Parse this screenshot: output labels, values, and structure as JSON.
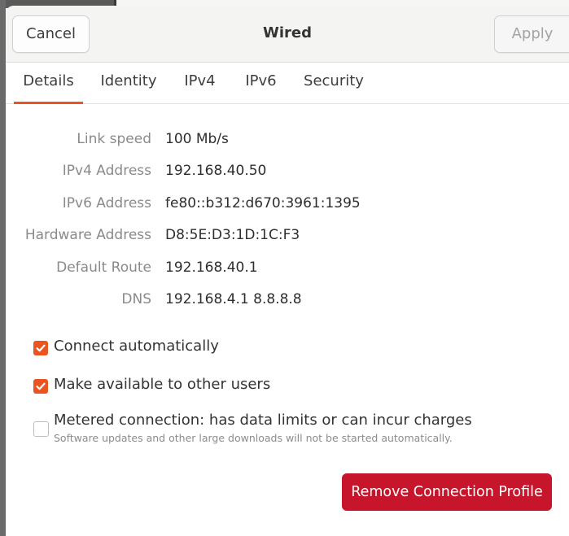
{
  "window": {
    "title": "Wired",
    "cancel_label": "Cancel",
    "apply_label": "Apply"
  },
  "tabs": [
    {
      "label": "Details",
      "active": true
    },
    {
      "label": "Identity",
      "active": false
    },
    {
      "label": "IPv4",
      "active": false
    },
    {
      "label": "IPv6",
      "active": false
    },
    {
      "label": "Security",
      "active": false
    }
  ],
  "details": [
    {
      "label": "Link speed",
      "value": "100 Mb/s"
    },
    {
      "label": "IPv4 Address",
      "value": "192.168.40.50"
    },
    {
      "label": "IPv6 Address",
      "value": "fe80::b312:d670:3961:1395"
    },
    {
      "label": "Hardware Address",
      "value": "D8:5E:D3:1D:1C:F3"
    },
    {
      "label": "Default Route",
      "value": "192.168.40.1"
    },
    {
      "label": "DNS",
      "value": "192.168.4.1 8.8.8.8"
    }
  ],
  "options": {
    "connect_automatically": {
      "label": "Connect automatically",
      "checked": true
    },
    "available_to_others": {
      "label": "Make available to other users",
      "checked": true
    },
    "metered": {
      "label": "Metered connection: has data limits or can incur charges",
      "sublabel": "Software updates and other large downloads will not be started automatically.",
      "checked": false
    }
  },
  "remove_label": "Remove Connection Profile",
  "colors": {
    "accent": "#e95420",
    "destructive": "#c7162b"
  }
}
